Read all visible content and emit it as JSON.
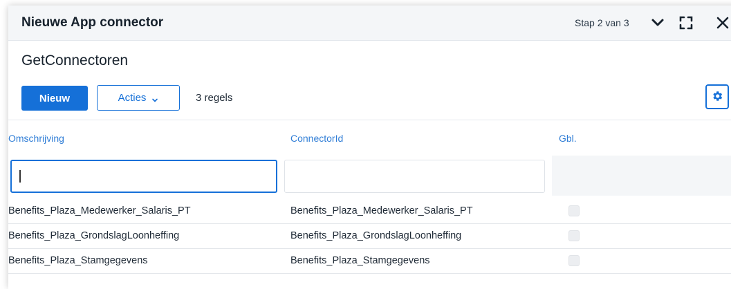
{
  "dialog": {
    "title": "Nieuwe App connector",
    "step": "Stap 2 van 3",
    "subtitle": "GetConnectoren"
  },
  "toolbar": {
    "new_label": "Nieuw",
    "actions_label": "Acties",
    "row_count": "3 regels"
  },
  "table": {
    "columns": [
      "Omschrijving",
      "ConnectorId",
      "Gbl."
    ],
    "filters": {
      "omschrijving": "",
      "connectorid": ""
    },
    "rows": [
      {
        "omschrijving": "Benefits_Plaza_Medewerker_Salaris_PT",
        "connectorid": "Benefits_Plaza_Medewerker_Salaris_PT",
        "gbl": false
      },
      {
        "omschrijving": "Benefits_Plaza_GrondslagLoonheffing",
        "connectorid": "Benefits_Plaza_GrondslagLoonheffing",
        "gbl": false
      },
      {
        "omschrijving": "Benefits_Plaza_Stamgegevens",
        "connectorid": "Benefits_Plaza_Stamgegevens",
        "gbl": false
      }
    ]
  },
  "icons": {
    "collapse": "chevron-down-icon",
    "expand": "expand-icon",
    "close": "close-icon",
    "settings": "gear-icon"
  },
  "colors": {
    "accent": "#1570d8",
    "header_link": "#2f7dd6",
    "titlebar_bg": "#f4f6f8"
  }
}
